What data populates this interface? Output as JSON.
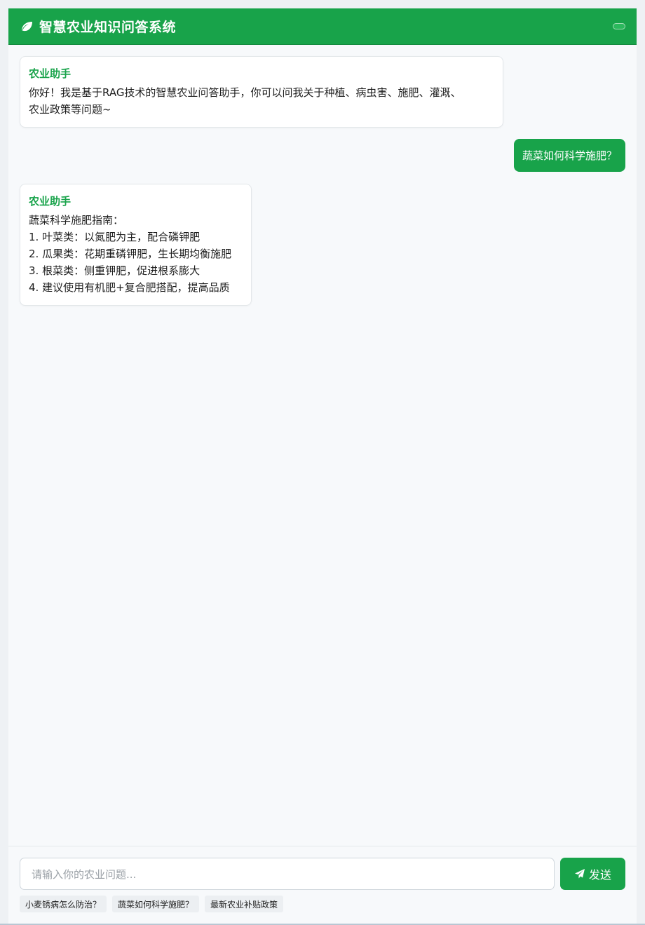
{
  "header": {
    "title": "智慧农业知识问答系统",
    "icon": "leaf-icon",
    "menu_icon": "menu-toggle-icon"
  },
  "messages": [
    {
      "role": "bot",
      "sender": "农业助手",
      "lines": [
        "你好！我是基于RAG技术的智慧农业问答助手，你可以问我关于种植、病虫害、施肥、灌溉、",
        "农业政策等问题~"
      ]
    },
    {
      "role": "user",
      "text": "蔬菜如何科学施肥？"
    },
    {
      "role": "bot",
      "sender": "农业助手",
      "lines": [
        "蔬菜科学施肥指南：",
        "1. 叶菜类：以氮肥为主，配合磷钾肥",
        "2. 瓜果类：花期重磷钾肥，生长期均衡施肥",
        "3. 根菜类：侧重钾肥，促进根系膨大",
        "4. 建议使用有机肥+复合肥搭配，提高品质"
      ]
    }
  ],
  "input": {
    "placeholder": "请输入你的农业问题..."
  },
  "send_button": {
    "label": "发送",
    "icon": "paper-plane-icon"
  },
  "suggestions": [
    "小麦锈病怎么防治？",
    "蔬菜如何科学施肥？",
    "最新农业补贴政策"
  ],
  "colors": {
    "brand": "#18a34a",
    "background": "#f7f9fb"
  }
}
